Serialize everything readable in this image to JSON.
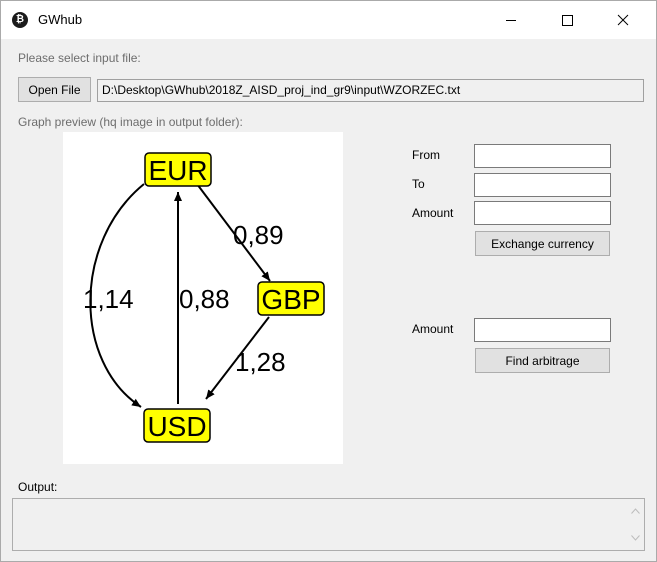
{
  "window": {
    "title": "GWhub",
    "app_icon_glyph": "₿"
  },
  "file": {
    "select_label": "Please select input file:",
    "open_button": "Open File",
    "path": "D:\\Desktop\\GWhub\\2018Z_AISD_proj_ind_gr9\\input\\WZORZEC.txt"
  },
  "graph": {
    "label": "Graph preview (hq image in output folder):",
    "nodes": {
      "eur": "EUR",
      "gbp": "GBP",
      "usd": "USD"
    },
    "edges": {
      "eur_gbp": "0,89",
      "eur_usd": "1,14",
      "usd_eur": "0,88",
      "gbp_usd": "1,28"
    },
    "node_fill": "#ffff00"
  },
  "exchange": {
    "from_label": "From",
    "to_label": "To",
    "amount_label": "Amount",
    "from_value": "",
    "to_value": "",
    "amount_value": "",
    "button": "Exchange currency"
  },
  "arbitrage": {
    "amount_label": "Amount",
    "amount_value": "",
    "button": "Find arbitrage"
  },
  "output": {
    "label": "Output:",
    "text": ""
  },
  "icons": {
    "app": "bitcoin-icon",
    "minimize": "minimize-icon",
    "maximize": "maximize-icon",
    "close": "close-icon",
    "scroll_up": "chevron-up-icon",
    "scroll_down": "chevron-down-icon"
  }
}
